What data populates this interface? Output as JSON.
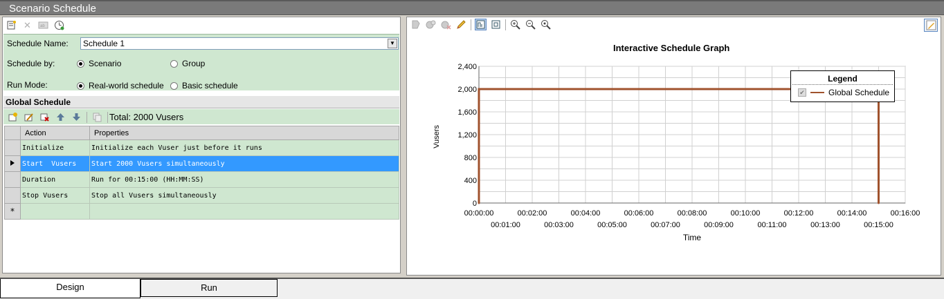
{
  "window": {
    "title": "Scenario Schedule"
  },
  "left_toolbar": {
    "icons": [
      "new-schedule-icon",
      "delete-icon",
      "rename-icon",
      "schedule-clock-icon"
    ]
  },
  "form": {
    "schedule_name_label": "Schedule Name:",
    "schedule_name_value": "Schedule 1",
    "schedule_by_label": "Schedule by:",
    "schedule_by_options": [
      "Scenario",
      "Group"
    ],
    "schedule_by_selected": "Scenario",
    "run_mode_label": "Run Mode:",
    "run_mode_options": [
      "Real-world schedule",
      "Basic schedule"
    ],
    "run_mode_selected": "Real-world schedule"
  },
  "global_schedule": {
    "header": "Global Schedule",
    "total": "Total: 2000 Vusers",
    "columns": [
      "Action",
      "Properties"
    ],
    "rows": [
      {
        "action": "Initialize",
        "properties": "Initialize each Vuser just before it runs"
      },
      {
        "action": "Start  Vusers",
        "properties": "Start 2000 Vusers simultaneously",
        "selected": true
      },
      {
        "action": "Duration",
        "properties": "Run for 00:15:00 (HH:MM:SS)"
      },
      {
        "action": "Stop Vusers",
        "properties": "Stop all Vusers simultaneously"
      }
    ],
    "new_row_marker": "*"
  },
  "right_toolbar": {
    "icons": [
      "graph-tool-1-icon",
      "graph-tool-2-icon",
      "graph-tool-3-icon",
      "pencil-icon",
      "view-icon",
      "fit-icon",
      "zoom-in-icon",
      "zoom-out-icon",
      "zoom-reset-icon",
      "edit-graph-icon"
    ]
  },
  "chart_data": {
    "type": "line",
    "title": "Interactive Schedule Graph",
    "xlabel": "Time",
    "ylabel": "Vusers",
    "y_ticks": [
      "0",
      "400",
      "800",
      "1,200",
      "1,600",
      "2,000",
      "2,400"
    ],
    "ylim": [
      0,
      2400
    ],
    "x_ticks_top": [
      "00:00:00",
      "00:02:00",
      "00:04:00",
      "00:06:00",
      "00:08:00",
      "00:10:00",
      "00:12:00",
      "00:14:00",
      "00:16:00"
    ],
    "x_ticks_bottom": [
      "00:01:00",
      "00:03:00",
      "00:05:00",
      "00:07:00",
      "00:09:00",
      "00:11:00",
      "00:13:00",
      "00:15:00"
    ],
    "xlim_minutes": [
      0,
      16
    ],
    "grid": true,
    "legend_title": "Legend",
    "legend_placement": "top-right",
    "series": [
      {
        "name": "Global Schedule",
        "color": "#a0522d",
        "points": [
          {
            "x": "00:00:00",
            "y": 0
          },
          {
            "x": "00:00:00",
            "y": 2000
          },
          {
            "x": "00:15:00",
            "y": 2000
          },
          {
            "x": "00:15:00",
            "y": 0
          }
        ]
      }
    ]
  },
  "tabs": [
    {
      "label": "Design",
      "active": true
    },
    {
      "label": "Run",
      "active": false
    }
  ]
}
